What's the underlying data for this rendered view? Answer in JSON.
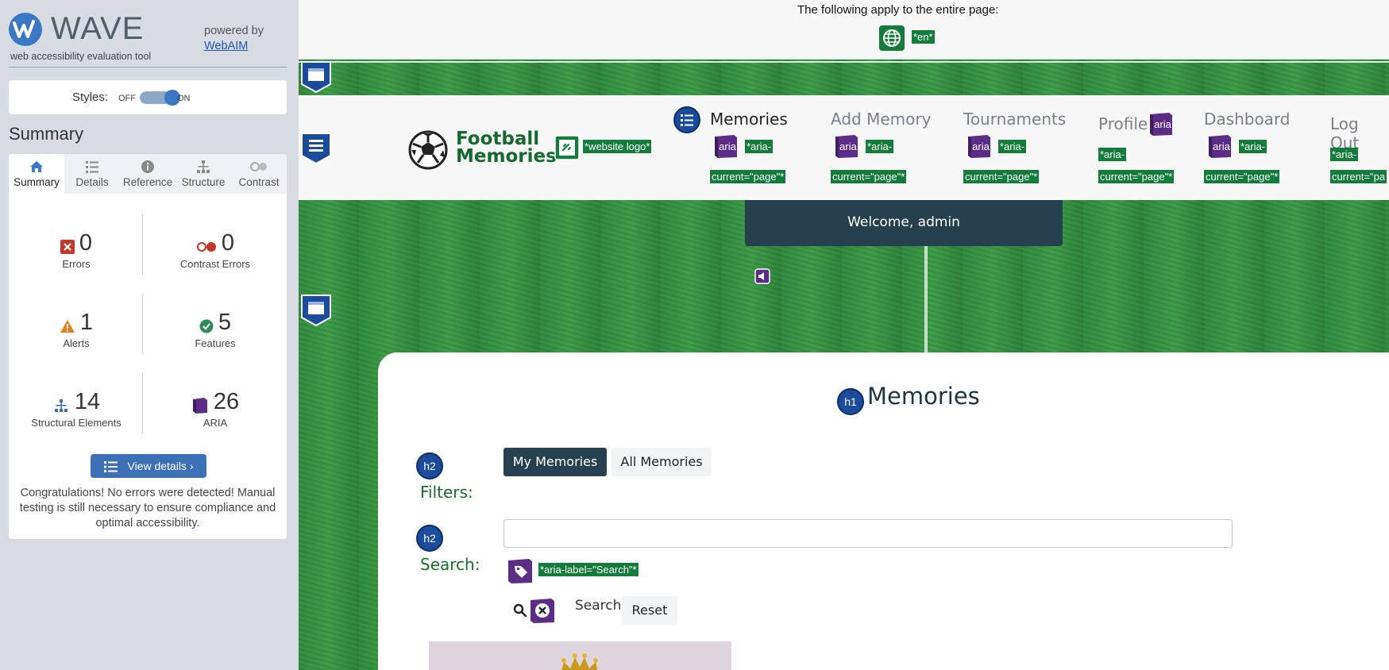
{
  "wave": {
    "name": "WAVE",
    "subtitle": "web accessibility evaluation tool",
    "powered_by": "powered by",
    "webaim": "WebAIM",
    "styles_label": "Styles:",
    "styles_off": "OFF",
    "styles_on": "ON",
    "summary_title": "Summary",
    "tabs": [
      {
        "label": "Summary",
        "icon": "home-icon",
        "active": true
      },
      {
        "label": "Details",
        "icon": "list-icon",
        "active": false
      },
      {
        "label": "Reference",
        "icon": "info-icon",
        "active": false
      },
      {
        "label": "Structure",
        "icon": "hierarchy-icon",
        "active": false
      },
      {
        "label": "Contrast",
        "icon": "contrast-icon",
        "active": false
      }
    ],
    "stats": {
      "errors": {
        "value": "0",
        "label": "Errors"
      },
      "contrast_errors": {
        "value": "0",
        "label": "Contrast Errors"
      },
      "alerts": {
        "value": "1",
        "label": "Alerts"
      },
      "features": {
        "value": "5",
        "label": "Features"
      },
      "structural": {
        "value": "14",
        "label": "Structural Elements"
      },
      "aria": {
        "value": "26",
        "label": "ARIA"
      }
    },
    "view_details": "View details ›",
    "congrats": "Congratulations! No errors were detected! Manual testing is still necessary to ensure compliance and optimal accessibility.",
    "colors": {
      "accent": "#3b78c4",
      "error": "#c0392b",
      "alert": "#e67e22",
      "feature": "#2e8b57",
      "aria": "#5b2d86"
    }
  },
  "page": {
    "top_notice": "The following apply to the entire page:",
    "lang_tag": "*en*",
    "brand_line1": "Football",
    "brand_line2": "Memories",
    "logo_tag": "*website logo*",
    "nav": [
      {
        "label": "Memories",
        "tag1": "*aria-",
        "tag2": "current=\"page\"*"
      },
      {
        "label": "Add Memory",
        "tag1": "*aria-",
        "tag2": "current=\"page\"*"
      },
      {
        "label": "Tournaments",
        "tag1": "*aria-",
        "tag2": "current=\"page\"*"
      },
      {
        "label": "Profile",
        "tag1": "*aria-",
        "tag2": "current=\"page\"*"
      },
      {
        "label": "Dashboard",
        "tag1": "*aria-",
        "tag2": "current=\"page\"*"
      },
      {
        "label": "Log Out",
        "tag1": "*aria-",
        "tag2": "current=\"pa"
      }
    ],
    "aria_icon_text": "aria",
    "welcome": "Welcome, admin",
    "h1_badge": "h1",
    "h2_badge": "h2",
    "heading": "Memories",
    "filters_label": "Filters:",
    "search_label": "Search:",
    "my_memories": "My Memories",
    "all_memories": "All Memories",
    "search_input_value": "",
    "aria_label_tag": "*aria-label=\"Search\"*",
    "search_button": "Search",
    "reset_button": "Reset"
  }
}
